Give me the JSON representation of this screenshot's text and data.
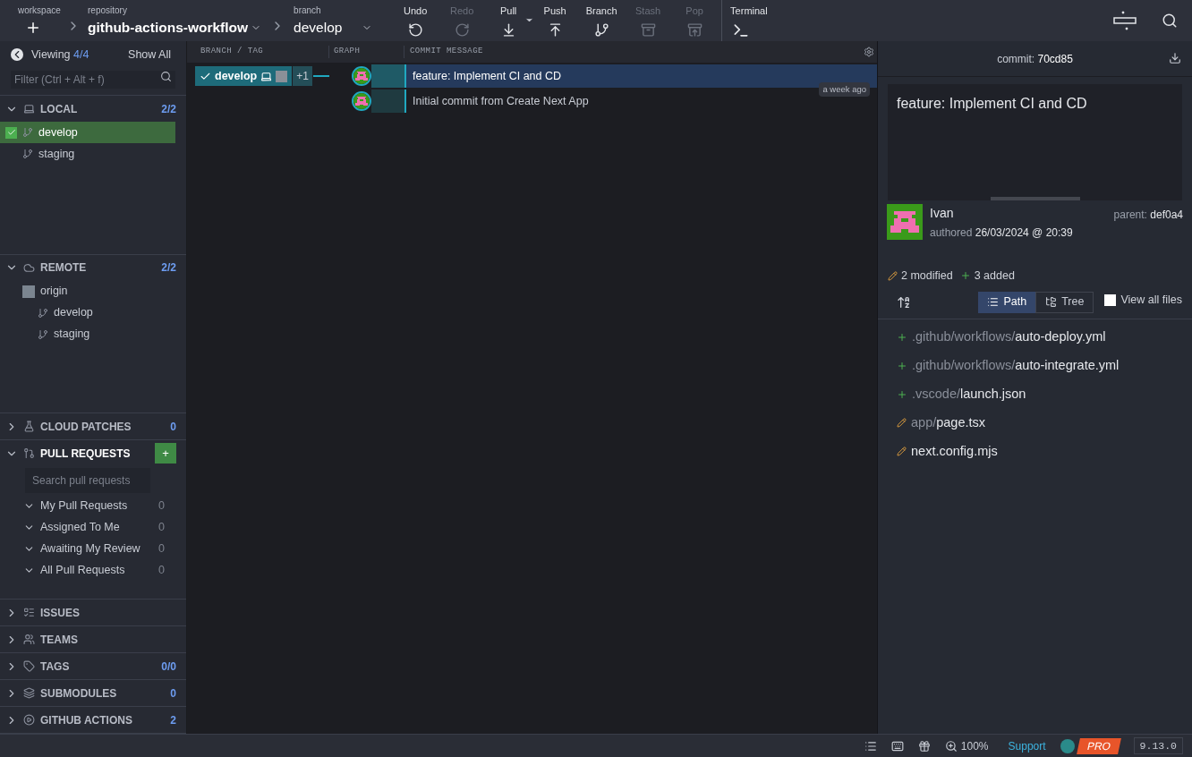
{
  "toolbar": {
    "workspace": {
      "label": "workspace"
    },
    "repository": {
      "label": "repository",
      "value": "github-actions-workflow"
    },
    "branch": {
      "label": "branch",
      "value": "develop"
    },
    "actions": [
      {
        "label": "Undo",
        "disabled": false
      },
      {
        "label": "Redo",
        "disabled": true
      },
      {
        "label": "Pull",
        "disabled": false
      },
      {
        "label": "Push",
        "disabled": false
      },
      {
        "label": "Branch",
        "disabled": false
      },
      {
        "label": "Stash",
        "disabled": true
      },
      {
        "label": "Pop",
        "disabled": true
      }
    ],
    "terminal": {
      "label": "Terminal"
    }
  },
  "sidebar": {
    "viewing": {
      "label": "Viewing",
      "count": "4/4",
      "show_all": "Show All"
    },
    "filter": {
      "placeholder": "Filter (Ctrl + Alt + f)"
    },
    "sections": [
      {
        "kind": "branches",
        "title": "LOCAL",
        "count": "2/2",
        "expanded": true,
        "items": [
          {
            "name": "develop",
            "selected": true
          },
          {
            "name": "staging",
            "selected": false
          }
        ]
      },
      {
        "kind": "remotes",
        "title": "REMOTE",
        "count": "2/2",
        "expanded": true,
        "items": [
          {
            "name": "origin",
            "children": [
              {
                "name": "develop"
              },
              {
                "name": "staging"
              }
            ]
          }
        ]
      },
      {
        "kind": "plain",
        "title": "CLOUD PATCHES",
        "count": "0",
        "expanded": false
      },
      {
        "kind": "pulls",
        "title": "PULL REQUESTS",
        "expanded": true,
        "add": "+",
        "search": {
          "placeholder": "Search pull requests"
        },
        "items": [
          {
            "name": "My Pull Requests",
            "count": "0"
          },
          {
            "name": "Assigned To Me",
            "count": "0"
          },
          {
            "name": "Awaiting My Review",
            "count": "0"
          },
          {
            "name": "All Pull Requests",
            "count": "0"
          }
        ]
      },
      {
        "kind": "plain",
        "title": "ISSUES",
        "expanded": false
      },
      {
        "kind": "plain",
        "title": "TEAMS",
        "expanded": false
      },
      {
        "kind": "plain",
        "title": "TAGS",
        "count": "0/0",
        "expanded": false
      },
      {
        "kind": "plain",
        "title": "SUBMODULES",
        "count": "0",
        "expanded": false
      },
      {
        "kind": "plain",
        "title": "GITHUB ACTIONS",
        "count": "2",
        "expanded": false
      }
    ]
  },
  "graph": {
    "columns": [
      "BRANCH / TAG",
      "GRAPH",
      "COMMIT MESSAGE"
    ],
    "commits": [
      {
        "message": "feature: Implement CI and CD",
        "selected": true,
        "branch": "develop",
        "extra": "+1"
      },
      {
        "message": "Initial commit from Create Next App",
        "selected": false
      }
    ],
    "time_badge": "a week ago"
  },
  "details": {
    "commit_label": "commit:",
    "commit_id": "70cd85",
    "message": "feature: Implement CI and CD",
    "author": "Ivan",
    "authored_label": "authored",
    "date": "26/03/2024 @ 20:39",
    "parent_label": "parent:",
    "parent_id": "def0a4",
    "modified": "2 modified",
    "added": "3 added",
    "views": [
      {
        "label": "Path",
        "selected": true
      },
      {
        "label": "Tree",
        "selected": false
      }
    ],
    "view_all": {
      "label": "View all files",
      "checked": false
    },
    "files": [
      {
        "dir": ".github/workflows/",
        "name": "auto-deploy.yml",
        "kind": "added"
      },
      {
        "dir": ".github/workflows/",
        "name": "auto-integrate.yml",
        "kind": "added"
      },
      {
        "dir": ".vscode/",
        "name": "launch.json",
        "kind": "added"
      },
      {
        "dir": "app/",
        "name": "page.tsx",
        "kind": "modified"
      },
      {
        "name": "next.config.mjs",
        "kind": "modified"
      }
    ]
  },
  "status_bar": {
    "zoom": "100%",
    "support": "Support",
    "pro": "PRO",
    "version": "9.13.0"
  }
}
